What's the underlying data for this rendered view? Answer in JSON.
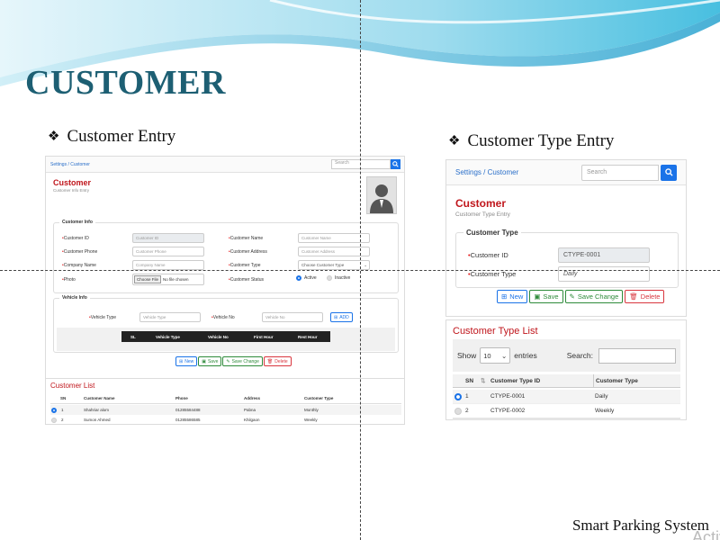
{
  "slide": {
    "title": "CUSTOMER",
    "footer": "Smart Parking System",
    "watermark": "Activ",
    "accent_color": "#1d5f73"
  },
  "left_section": {
    "heading": "Customer Entry",
    "breadcrumb": "Settings / Customer",
    "search_placeholder": "Search",
    "form_title": "Customer",
    "form_subtitle": "Customer Info Entry",
    "customer_info": {
      "legend": "Customer Info",
      "fields": [
        {
          "label": "Customer ID",
          "placeholder": "Customer ID"
        },
        {
          "label": "Customer Name",
          "placeholder": "Customer Name"
        },
        {
          "label": "Customer Phone",
          "placeholder": "Customer Phone"
        },
        {
          "label": "Customer Address",
          "placeholder": "Customer Address"
        },
        {
          "label": "Company Name",
          "placeholder": "Company Name"
        },
        {
          "label": "Customer Type",
          "placeholder": "Choose Customer Type"
        },
        {
          "label": "Photo",
          "file_button": "Choose File",
          "file_text": "No file chosen"
        },
        {
          "label": "Customer Status",
          "options": [
            "Active",
            "Inactive"
          ],
          "selected": "Active"
        }
      ]
    },
    "vehicle_info": {
      "legend": "Vehicle Info",
      "vehicle_type_label": "Vehicle Type",
      "vehicle_type_placeholder": "Vehicle Type",
      "vehicle_no_label": "Vehicle No",
      "vehicle_no_placeholder": "Vehicle No",
      "add_button": "ADD",
      "columns": [
        "SL",
        "Vehicle Type",
        "Vehicle No",
        "First Hour",
        "Rest Hour"
      ]
    },
    "buttons": {
      "new": "New",
      "save": "Save",
      "save_change": "Save Change",
      "delete": "Delete"
    },
    "list": {
      "title": "Customer List",
      "columns": [
        "SN",
        "Customer Name",
        "Phone",
        "Address",
        "Customer Type"
      ],
      "rows": [
        {
          "sn": "1",
          "name": "Shahriar alom",
          "phone": "01285584488",
          "address": "Pabna",
          "type": "Monthly",
          "selected": true
        },
        {
          "sn": "2",
          "name": "Sumon Ahmed",
          "phone": "01285586585",
          "address": "Khilgaon",
          "type": "Weekly",
          "selected": false
        }
      ]
    }
  },
  "right_section": {
    "heading": "Customer Type Entry",
    "breadcrumb": "Settings / Customer",
    "search_placeholder": "Search",
    "form_title": "Customer",
    "form_subtitle": "Customer Type Entry",
    "group": {
      "legend": "Customer Type",
      "id_label": "Customer ID",
      "id_value": "CTYPE-0001",
      "type_label": "Customer Type",
      "type_value": "Daily"
    },
    "buttons": {
      "new": "New",
      "save": "Save",
      "save_change": "Save Change",
      "delete": "Delete"
    },
    "list": {
      "title": "Customer Type List",
      "show_label": "Show",
      "page_length": "10",
      "entries_label": "entries",
      "search_label": "Search:",
      "columns": [
        "SN",
        "Customer Type ID",
        "Customer Type"
      ],
      "rows": [
        {
          "sn": "1",
          "type_id": "CTYPE-0001",
          "type": "Daily",
          "selected": true
        },
        {
          "sn": "2",
          "type_id": "CTYPE-0002",
          "type": "Weekly",
          "selected": false
        }
      ]
    }
  }
}
